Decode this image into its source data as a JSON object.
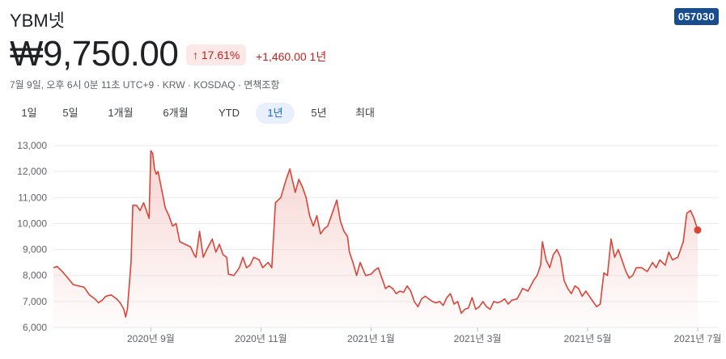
{
  "header": {
    "title": "YBM넷",
    "ticker": "057030",
    "price": "₩9,750.00",
    "change_pct": "17.61%",
    "change_abs": "+1,460.00 1년",
    "meta": "7월 9일, 오후 6시 0분 11초 UTC+9 · KRW · KOSDAQ · 면책조항"
  },
  "tabs": [
    {
      "label": "1일"
    },
    {
      "label": "5일"
    },
    {
      "label": "1개월"
    },
    {
      "label": "6개월"
    },
    {
      "label": "YTD"
    },
    {
      "label": "1년",
      "active": true
    },
    {
      "label": "5년"
    },
    {
      "label": "최대"
    }
  ],
  "colors": {
    "line": "#db4437",
    "fill": "#f4c7c3",
    "badge_bg": "#fce8e6",
    "accent": "#c5221f",
    "ticker_bg": "#1a4d8f"
  },
  "chart_data": {
    "type": "area",
    "ylim": [
      6000,
      13000
    ],
    "y_ticks": [
      13000,
      12000,
      11000,
      10000,
      9000,
      8000,
      7000,
      6000
    ],
    "y_tick_labels": [
      "13,000",
      "12,000",
      "11,000",
      "10,000",
      "9,000",
      "8,000",
      "7,000",
      "6,000"
    ],
    "x_ticks": [
      "2020-09-01",
      "2020-11-01",
      "2021-01-01",
      "2021-03-01",
      "2021-05-01",
      "2021-07-01"
    ],
    "x_tick_labels": [
      "2020년 9월",
      "2020년 11월",
      "2021년 1월",
      "2021년 3월",
      "2021년 5월",
      "2021년 7월"
    ],
    "grid": true,
    "series": [
      {
        "points": [
          [
            "2020-07-09",
            8300
          ],
          [
            "2020-07-11",
            8350
          ],
          [
            "2020-07-14",
            8150
          ],
          [
            "2020-07-17",
            7900
          ],
          [
            "2020-07-20",
            7650
          ],
          [
            "2020-07-23",
            7600
          ],
          [
            "2020-07-26",
            7550
          ],
          [
            "2020-07-29",
            7250
          ],
          [
            "2020-08-01",
            7100
          ],
          [
            "2020-08-03",
            6950
          ],
          [
            "2020-08-05",
            7050
          ],
          [
            "2020-08-07",
            7200
          ],
          [
            "2020-08-10",
            7250
          ],
          [
            "2020-08-13",
            7100
          ],
          [
            "2020-08-15",
            6950
          ],
          [
            "2020-08-17",
            6700
          ],
          [
            "2020-08-18",
            6400
          ],
          [
            "2020-08-19",
            6700
          ],
          [
            "2020-08-21",
            8500
          ],
          [
            "2020-08-22",
            10700
          ],
          [
            "2020-08-24",
            10700
          ],
          [
            "2020-08-26",
            10500
          ],
          [
            "2020-08-28",
            10800
          ],
          [
            "2020-08-31",
            10200
          ],
          [
            "2020-09-01",
            12800
          ],
          [
            "2020-09-02",
            12700
          ],
          [
            "2020-09-03",
            12100
          ],
          [
            "2020-09-04",
            11900
          ],
          [
            "2020-09-05",
            12000
          ],
          [
            "2020-09-07",
            11300
          ],
          [
            "2020-09-09",
            10600
          ],
          [
            "2020-09-11",
            10300
          ],
          [
            "2020-09-13",
            9900
          ],
          [
            "2020-09-15",
            10000
          ],
          [
            "2020-09-17",
            9300
          ],
          [
            "2020-09-20",
            9200
          ],
          [
            "2020-09-23",
            9100
          ],
          [
            "2020-09-25",
            8800
          ],
          [
            "2020-09-26",
            8700
          ],
          [
            "2020-09-28",
            9700
          ],
          [
            "2020-09-30",
            8700
          ],
          [
            "2020-10-02",
            9000
          ],
          [
            "2020-10-05",
            9400
          ],
          [
            "2020-10-07",
            8900
          ],
          [
            "2020-10-09",
            9200
          ],
          [
            "2020-10-11",
            8800
          ],
          [
            "2020-10-13",
            8700
          ],
          [
            "2020-10-14",
            8050
          ],
          [
            "2020-10-17",
            8000
          ],
          [
            "2020-10-20",
            8300
          ],
          [
            "2020-10-22",
            8700
          ],
          [
            "2020-10-24",
            8300
          ],
          [
            "2020-10-26",
            8400
          ],
          [
            "2020-10-28",
            8700
          ],
          [
            "2020-10-31",
            8600
          ],
          [
            "2020-11-02",
            8300
          ],
          [
            "2020-11-05",
            8500
          ],
          [
            "2020-11-07",
            8300
          ],
          [
            "2020-11-09",
            10800
          ],
          [
            "2020-11-12",
            11000
          ],
          [
            "2020-11-15",
            11700
          ],
          [
            "2020-11-17",
            12100
          ],
          [
            "2020-11-20",
            11200
          ],
          [
            "2020-11-22",
            11700
          ],
          [
            "2020-11-24",
            11400
          ],
          [
            "2020-11-26",
            11000
          ],
          [
            "2020-11-28",
            10300
          ],
          [
            "2020-11-30",
            9900
          ],
          [
            "2020-12-02",
            10300
          ],
          [
            "2020-12-04",
            9600
          ],
          [
            "2020-12-06",
            9800
          ],
          [
            "2020-12-08",
            9900
          ],
          [
            "2020-12-10",
            10300
          ],
          [
            "2020-12-13",
            10900
          ],
          [
            "2020-12-15",
            10100
          ],
          [
            "2020-12-17",
            9700
          ],
          [
            "2020-12-19",
            9500
          ],
          [
            "2020-12-20",
            8900
          ],
          [
            "2020-12-22",
            8500
          ],
          [
            "2020-12-24",
            8000
          ],
          [
            "2020-12-26",
            8500
          ],
          [
            "2020-12-29",
            8000
          ],
          [
            "2021-01-01",
            8050
          ],
          [
            "2021-01-03",
            8200
          ],
          [
            "2021-01-05",
            8300
          ],
          [
            "2021-01-07",
            7900
          ],
          [
            "2021-01-09",
            7500
          ],
          [
            "2021-01-11",
            7600
          ],
          [
            "2021-01-13",
            7500
          ],
          [
            "2021-01-15",
            7300
          ],
          [
            "2021-01-17",
            7400
          ],
          [
            "2021-01-19",
            7350
          ],
          [
            "2021-01-21",
            7600
          ],
          [
            "2021-01-23",
            7400
          ],
          [
            "2021-01-25",
            7000
          ],
          [
            "2021-01-27",
            6800
          ],
          [
            "2021-01-29",
            7100
          ],
          [
            "2021-01-31",
            7200
          ],
          [
            "2021-02-02",
            7100
          ],
          [
            "2021-02-04",
            7000
          ],
          [
            "2021-02-06",
            6950
          ],
          [
            "2021-02-08",
            7000
          ],
          [
            "2021-02-10",
            6850
          ],
          [
            "2021-02-12",
            7150
          ],
          [
            "2021-02-14",
            7300
          ],
          [
            "2021-02-16",
            6900
          ],
          [
            "2021-02-18",
            7000
          ],
          [
            "2021-02-20",
            6550
          ],
          [
            "2021-02-22",
            6700
          ],
          [
            "2021-02-24",
            6750
          ],
          [
            "2021-02-26",
            7150
          ],
          [
            "2021-02-28",
            6700
          ],
          [
            "2021-03-02",
            6800
          ],
          [
            "2021-03-04",
            7000
          ],
          [
            "2021-03-06",
            6800
          ],
          [
            "2021-03-08",
            6700
          ],
          [
            "2021-03-10",
            7000
          ],
          [
            "2021-03-12",
            6950
          ],
          [
            "2021-03-14",
            7000
          ],
          [
            "2021-03-16",
            7100
          ],
          [
            "2021-03-18",
            6900
          ],
          [
            "2021-03-20",
            7050
          ],
          [
            "2021-03-23",
            7100
          ],
          [
            "2021-03-26",
            7500
          ],
          [
            "2021-03-29",
            7400
          ],
          [
            "2021-04-01",
            7800
          ],
          [
            "2021-04-03",
            8000
          ],
          [
            "2021-04-05",
            8400
          ],
          [
            "2021-04-06",
            9300
          ],
          [
            "2021-04-08",
            8600
          ],
          [
            "2021-04-10",
            8300
          ],
          [
            "2021-04-12",
            8800
          ],
          [
            "2021-04-14",
            9000
          ],
          [
            "2021-04-16",
            8700
          ],
          [
            "2021-04-18",
            7800
          ],
          [
            "2021-04-20",
            7500
          ],
          [
            "2021-04-22",
            7300
          ],
          [
            "2021-04-24",
            7600
          ],
          [
            "2021-04-26",
            7500
          ],
          [
            "2021-04-28",
            7200
          ],
          [
            "2021-04-30",
            7400
          ],
          [
            "2021-05-02",
            7200
          ],
          [
            "2021-05-04",
            7000
          ],
          [
            "2021-05-06",
            6800
          ],
          [
            "2021-05-08",
            6900
          ],
          [
            "2021-05-10",
            8100
          ],
          [
            "2021-05-12",
            8000
          ],
          [
            "2021-05-14",
            9400
          ],
          [
            "2021-05-16",
            8700
          ],
          [
            "2021-05-18",
            9000
          ],
          [
            "2021-05-20",
            8600
          ],
          [
            "2021-05-22",
            8200
          ],
          [
            "2021-05-24",
            7900
          ],
          [
            "2021-05-26",
            8000
          ],
          [
            "2021-05-28",
            8300
          ],
          [
            "2021-05-31",
            8300
          ],
          [
            "2021-06-03",
            8150
          ],
          [
            "2021-06-06",
            8500
          ],
          [
            "2021-06-08",
            8300
          ],
          [
            "2021-06-10",
            8600
          ],
          [
            "2021-06-13",
            8400
          ],
          [
            "2021-06-15",
            8900
          ],
          [
            "2021-06-17",
            8600
          ],
          [
            "2021-06-20",
            8700
          ],
          [
            "2021-06-23",
            9300
          ],
          [
            "2021-06-25",
            10400
          ],
          [
            "2021-06-27",
            10500
          ],
          [
            "2021-06-29",
            10200
          ],
          [
            "2021-07-01",
            9750
          ]
        ]
      }
    ]
  }
}
